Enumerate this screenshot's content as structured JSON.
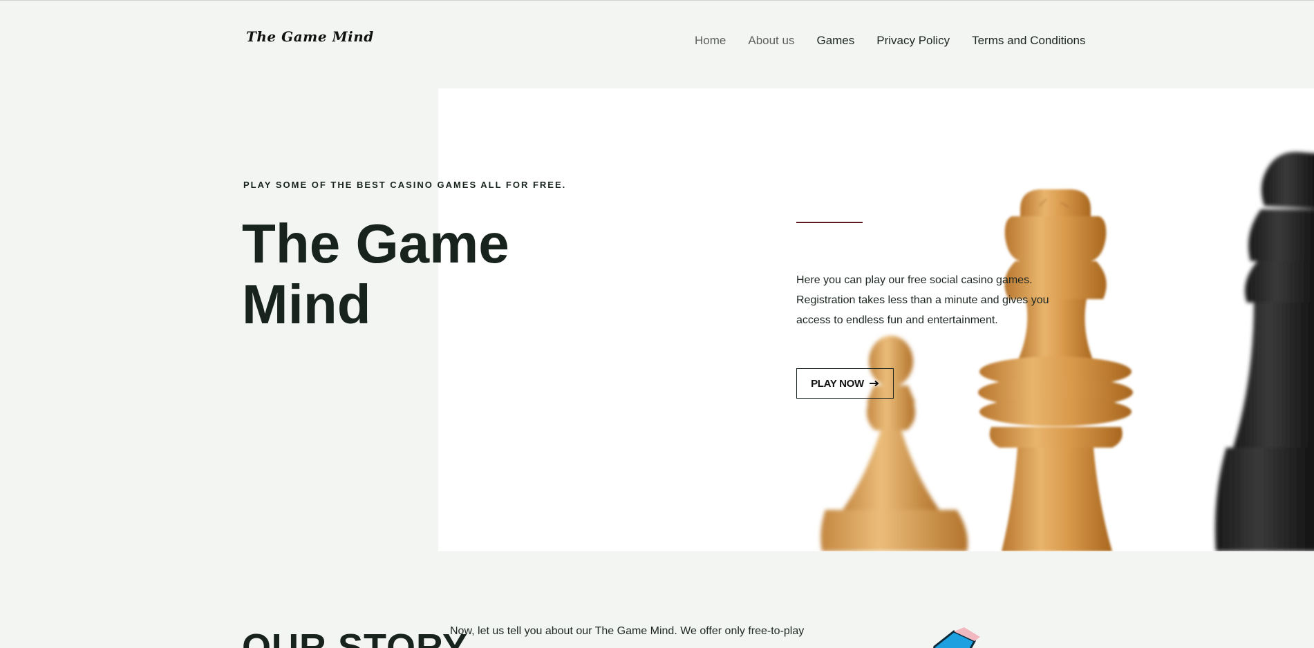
{
  "header": {
    "logo": "The Game Mind",
    "nav": [
      "Home",
      "About us",
      "Games",
      "Privacy Policy",
      "Terms and Conditions"
    ]
  },
  "hero": {
    "tagline": "PLAY SOME OF THE BEST CASINO GAMES ALL FOR FREE.",
    "title": "The Game Mind",
    "description": "Here you can play our free social casino games. Registration takes less than a minute and gives you access to endless fun and entertainment.",
    "cta_label": "PLAY NOW",
    "cta_icon": "arrow-right-icon",
    "accent_color": "#5a1a1f"
  },
  "story": {
    "heading": "OUR STORY",
    "text": "Now, let us tell you about our The Game Mind. We offer only free-to-play"
  },
  "colors": {
    "background": "#f3f5f2",
    "text": "#17231c",
    "panel": "#ffffff"
  }
}
